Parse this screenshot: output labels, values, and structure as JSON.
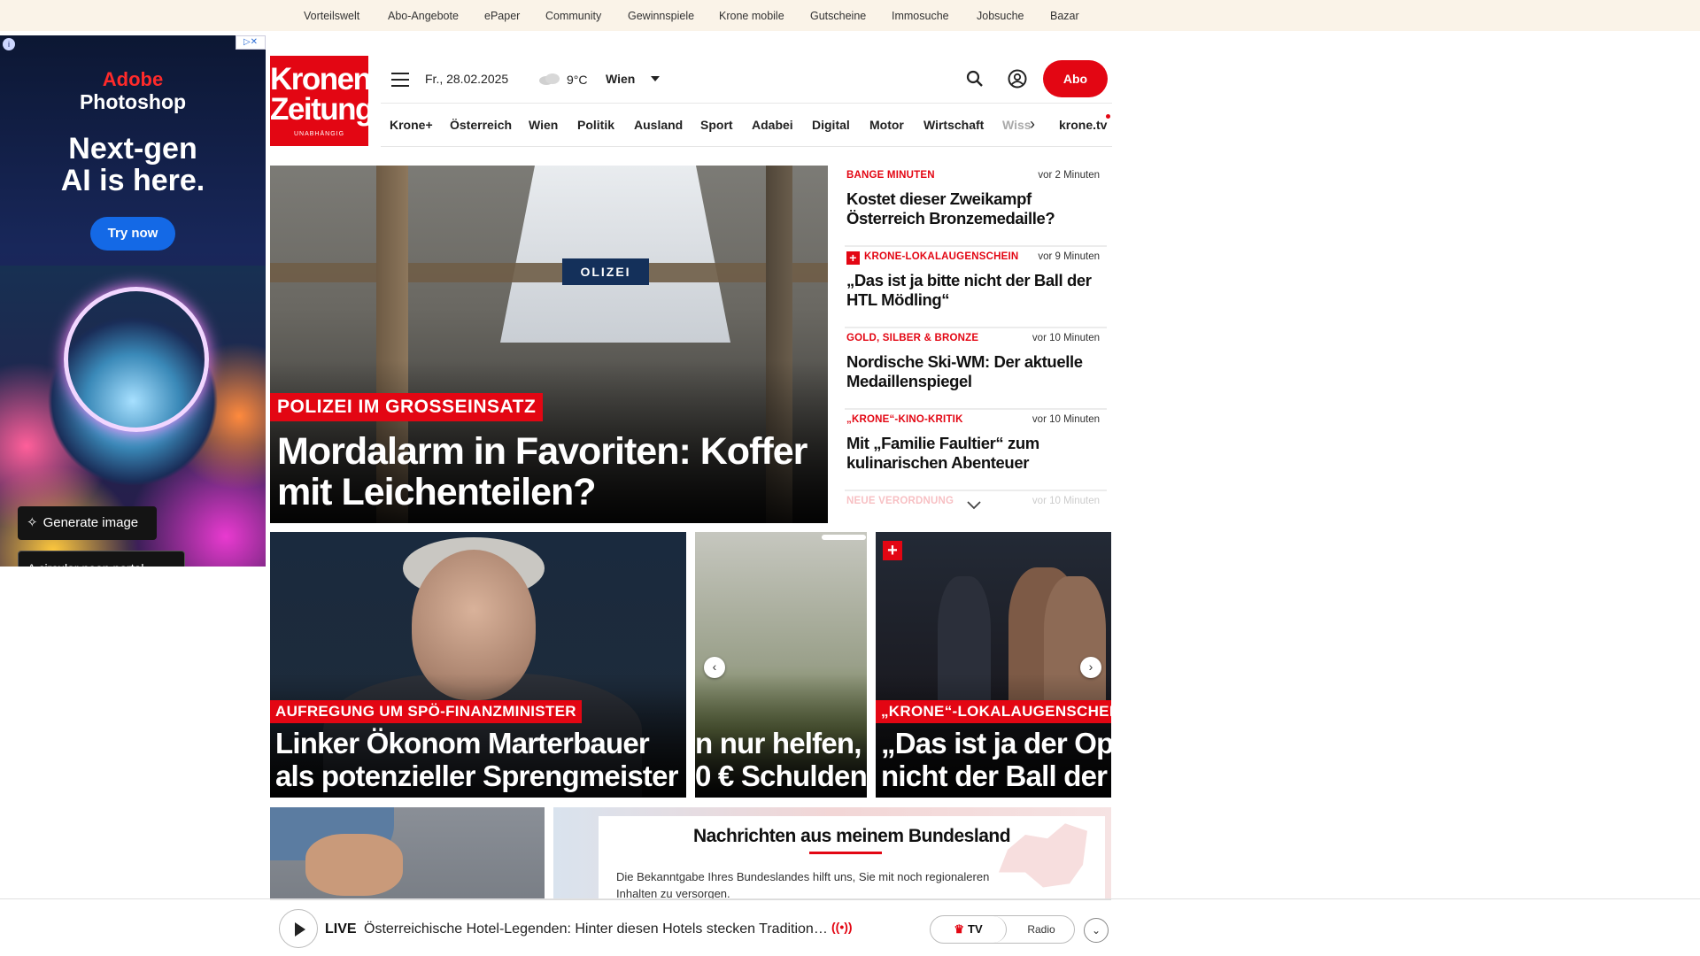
{
  "top_links": [
    "Vorteilswelt",
    "Abo-Angebote",
    "ePaper",
    "Community",
    "Gewinnspiele",
    "Krone mobile",
    "Gutscheine",
    "Immosuche",
    "Jobsuche",
    "Bazar"
  ],
  "ad": {
    "brand_line1": "Adobe",
    "brand_line2": "Photoshop",
    "headline_line1": "Next-gen",
    "headline_line2": "AI is here.",
    "cta": "Try now",
    "generate_label": "Generate image",
    "prompt_text": "A circular neon portal ...",
    "corner_label": "▷✕"
  },
  "header": {
    "logo_line1": "Kronen",
    "logo_line2": "Zeitung",
    "logo_tagline": "UNABHÄNGIG",
    "date": "Fr., 28.02.2025",
    "temperature": "9°C",
    "location": "Wien",
    "abo_label": "Abo"
  },
  "nav": {
    "items": [
      "Krone+",
      "Österreich",
      "Wien",
      "Politik",
      "Ausland",
      "Sport",
      "Adabei",
      "Digital",
      "Motor",
      "Wirtschaft"
    ],
    "faded_item": "Wiss",
    "tv_label": "krone.tv"
  },
  "hero": {
    "kicker": "POLIZEI IM GROSSEINSATZ",
    "title": "Mordalarm in Favoriten: Koffer mit Leichenteilen?",
    "sign_text": "OLIZEI"
  },
  "ticker": [
    {
      "kicker": "BANGE MINUTEN",
      "time": "vor 2 Minuten",
      "title": "Kostet dieser Zweikampf Österreich Bronzemedaille?",
      "plus": false
    },
    {
      "kicker": "KRONE-LOKALAUGENSCHEIN",
      "time": "vor 9 Minuten",
      "title": "„Das ist ja bitte nicht der Ball der HTL Mödling“",
      "plus": true
    },
    {
      "kicker": "GOLD, SILBER & BRONZE",
      "time": "vor 10 Minuten",
      "title": "Nordische Ski-WM: Der aktuelle Medaillenspiegel",
      "plus": false
    },
    {
      "kicker": "„KRONE“-KINO-KRITIK",
      "time": "vor 10 Minuten",
      "title": "Mit „Familie Faultier“ zum kulinarischen Abenteuer",
      "plus": false
    },
    {
      "kicker": "NEUE VERORDNUNG",
      "time": "vor 10 Minuten",
      "title": "",
      "plus": false
    }
  ],
  "cards": [
    {
      "kicker": "AUFREGUNG UM SPÖ-FINANZMINISTER",
      "title_line1": "Linker Ökonom Marterbauer",
      "title_line2": "als potenzieller Sprengmeister"
    },
    {
      "kicker": "",
      "title_line1": "n nur helfen,",
      "title_line2": "0 € Schulden"
    },
    {
      "kicker": "„KRONE“-LOKALAUGENSCHEIN",
      "title_line1": "„Das ist ja der Ope",
      "title_line2": "nicht der Ball der"
    }
  ],
  "bundesland": {
    "heading": "Nachrichten aus meinem Bundesland",
    "text": "Die Bekanntgabe Ihres Bundeslandes hilft uns, Sie mit noch regionaleren Inhalten zu versorgen."
  },
  "live": {
    "label": "LIVE",
    "text": "Österreichische Hotel-Legenden: Hinter diesen Hotels stecken Tradition…",
    "signal": "((•))",
    "tv": "TV",
    "radio": "Radio"
  }
}
